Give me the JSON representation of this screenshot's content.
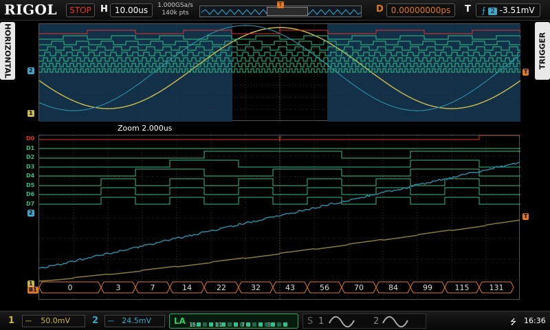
{
  "top": {
    "logo": "RIGOL",
    "run_state": "STOP",
    "h_label": "H",
    "timebase": "10.00us",
    "sample_rate": "1.000GSa/s",
    "mem_depth": "140k pts",
    "trigger_marker": "T",
    "d_label": "D",
    "delay": "0.00000000ps",
    "t_label": "T",
    "trigger_source": "2",
    "trigger_level": "-3.51mV"
  },
  "side": {
    "left_tab": "HORIZONTAL",
    "right_tab": "TRIGGER"
  },
  "zoom_label": "Zoom  2.000us",
  "digital_labels": [
    "D0",
    "D1",
    "D2",
    "D3",
    "D4",
    "D5",
    "D6",
    "D7"
  ],
  "channel_markers": {
    "ch1": "1",
    "ch2": "2",
    "trig": "T",
    "bus": "B1"
  },
  "bus_values": [
    "0",
    "3",
    "7",
    "14",
    "22",
    "32",
    "43",
    "56",
    "70",
    "84",
    "99",
    "115",
    "131"
  ],
  "bottom": {
    "ch1_num": "1",
    "ch1_scale": "50.0mV",
    "ch2_num": "2",
    "ch2_scale": "24.5mV",
    "la_label": "LA",
    "la_groups": [
      "15",
      "11",
      "7",
      "3"
    ],
    "s_label": "S",
    "s1": "1",
    "s2": "2",
    "time": "16:36"
  },
  "colors": {
    "ch1": "#c8b84a",
    "ch2": "#3fa6c8",
    "digital": "#2fc28a",
    "trigger": "#e07822",
    "d0": "#e0352a"
  }
}
